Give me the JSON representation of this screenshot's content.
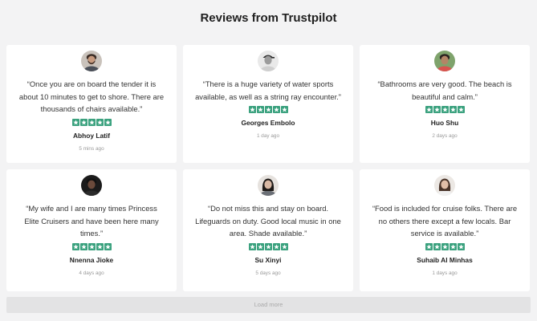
{
  "header": {
    "title": "Reviews from Trustpilot"
  },
  "colors": {
    "star": "#3aa17e",
    "background": "#f3f3f4",
    "card": "#ffffff"
  },
  "reviews": [
    {
      "avatar": "man-beard-glasses",
      "quote": "“Once you are on board the tender it is about 10 minutes to get to shore. There are thousands of chairs available.”",
      "rating": 5,
      "author": "Abhoy Latif",
      "time": "5 mins ago"
    },
    {
      "avatar": "man-cap",
      "quote": "“There is a huge variety of water sports available, as well as a string ray encounter.”",
      "rating": 5,
      "author": "Georges Embolo",
      "time": "1 day ago"
    },
    {
      "avatar": "man-colorful",
      "quote": "“Bathrooms are very good. The beach is beautiful and calm.”",
      "rating": 5,
      "author": "Huo Shu",
      "time": "2 days ago"
    },
    {
      "avatar": "woman-dark",
      "quote": "“My wife and I are many times Princess Elite Cruisers and have been here many times.”",
      "rating": 5,
      "author": "Nnenna Jioke",
      "time": "4 days ago"
    },
    {
      "avatar": "woman-long-hair",
      "quote": "“Do not miss this and stay on board. Lifeguards on duty. Good local music in one area. Shade available.”",
      "rating": 5,
      "author": "Su Xinyi",
      "time": "5 days ago"
    },
    {
      "avatar": "woman-smiling",
      "quote": "“Food is included for cruise folks. There are no others there except a few locals. Bar service is available.”",
      "rating": 5,
      "author": "Suhaib Al Minhas",
      "time": "1 days ago"
    }
  ],
  "footer": {
    "load_more_label": "Load more"
  }
}
